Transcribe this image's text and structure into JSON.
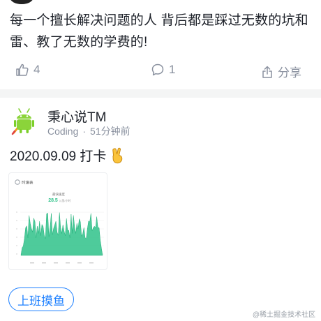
{
  "post1": {
    "text": "每一个擅长解决问题的人  背后都是踩过无数的坑和雷、教了无数的学费的!",
    "like_count": "4",
    "comment_count": "1",
    "share_label": "分享"
  },
  "post2": {
    "author": "秉心说TM",
    "author_meta": "Coding",
    "time": "51分钟前",
    "text": "2020.09.09 打卡",
    "tag": "上班摸鱼"
  },
  "screenshot": {
    "header": "时速表",
    "stat_label": "最快速度",
    "stat_value": "28.5",
    "stat_unit": "公里/小时",
    "accent": "#2fc28a"
  },
  "watermark": "@稀土掘金技术社区",
  "colors": {
    "accent_blue": "#1e80ff",
    "muted": "#8a919f"
  },
  "icons": [
    "thumb-up-icon",
    "comment-icon",
    "share-icon",
    "android-avatar-icon",
    "victory-hand-icon"
  ]
}
